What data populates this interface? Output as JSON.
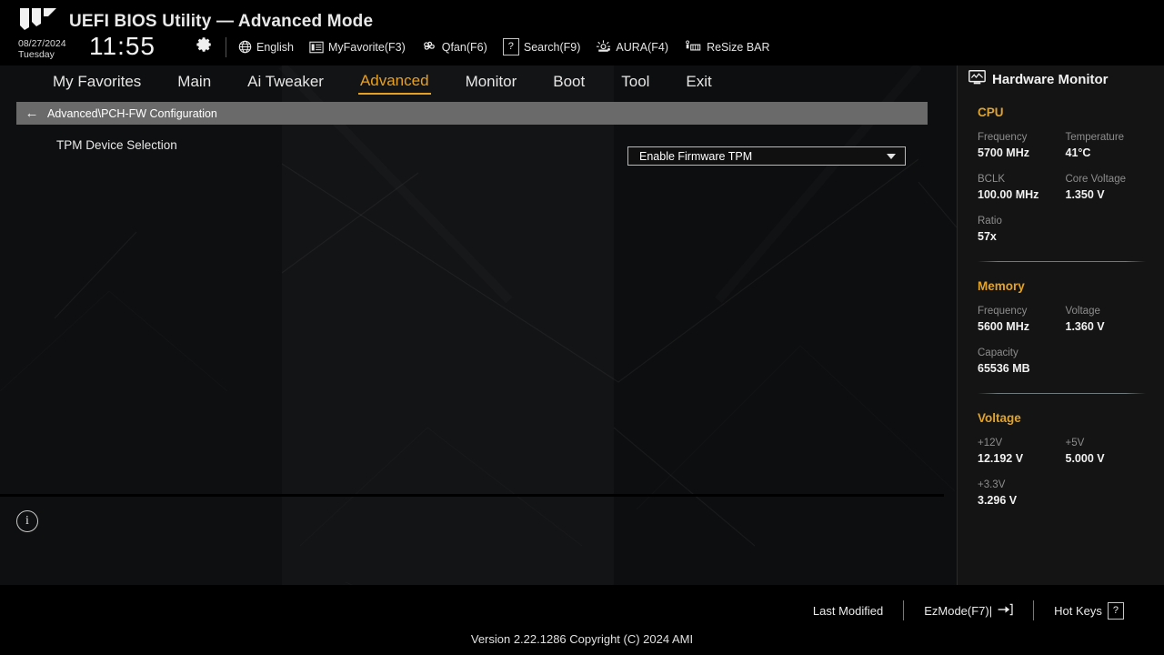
{
  "header": {
    "logo_icon": "tuf-logo-icon",
    "title": "UEFI BIOS Utility — Advanced Mode",
    "date": "08/27/2024",
    "weekday": "Tuesday",
    "time": "11:55",
    "gear_icon": "gear-icon",
    "items": [
      {
        "icon": "globe-icon",
        "label": "English"
      },
      {
        "icon": "list-icon",
        "label": "MyFavorite(F3)"
      },
      {
        "icon": "fan-icon",
        "label": "Qfan(F6)"
      },
      {
        "icon": "question-box-icon",
        "label": "Search(F9)"
      },
      {
        "icon": "aura-light-icon",
        "label": "AURA(F4)"
      },
      {
        "icon": "resize-bar-icon",
        "label": "ReSize BAR"
      }
    ]
  },
  "tabs": [
    {
      "label": "My Favorites",
      "active": false
    },
    {
      "label": "Main",
      "active": false
    },
    {
      "label": "Ai Tweaker",
      "active": false
    },
    {
      "label": "Advanced",
      "active": true
    },
    {
      "label": "Monitor",
      "active": false
    },
    {
      "label": "Boot",
      "active": false
    },
    {
      "label": "Tool",
      "active": false
    },
    {
      "label": "Exit",
      "active": false
    }
  ],
  "breadcrumb": {
    "back_icon": "arrow-left-icon",
    "path": "Advanced\\PCH-FW Configuration"
  },
  "main": {
    "options": [
      {
        "label": "TPM Device Selection",
        "value": "Enable Firmware TPM",
        "caret_icon": "chevron-down-icon"
      }
    ],
    "info_icon": "info-icon",
    "help_text": ""
  },
  "hardware_monitor": {
    "icon": "monitor-waveform-icon",
    "title": "Hardware Monitor",
    "groups": [
      {
        "name": "CPU",
        "rows": [
          [
            {
              "key": "Frequency",
              "value": "5700 MHz"
            },
            {
              "key": "Temperature",
              "value": "41°C"
            }
          ],
          [
            {
              "key": "BCLK",
              "value": "100.00 MHz"
            },
            {
              "key": "Core Voltage",
              "value": "1.350 V"
            }
          ],
          [
            {
              "key": "Ratio",
              "value": "57x"
            }
          ]
        ]
      },
      {
        "name": "Memory",
        "rows": [
          [
            {
              "key": "Frequency",
              "value": "5600 MHz"
            },
            {
              "key": "Voltage",
              "value": "1.360 V"
            }
          ],
          [
            {
              "key": "Capacity",
              "value": "65536 MB"
            }
          ]
        ]
      },
      {
        "name": "Voltage",
        "rows": [
          [
            {
              "key": "+12V",
              "value": "12.192 V"
            },
            {
              "key": "+5V",
              "value": "5.000 V"
            }
          ],
          [
            {
              "key": "+3.3V",
              "value": "3.296 V"
            }
          ]
        ]
      }
    ]
  },
  "footer": {
    "last_modified": "Last Modified",
    "ezmode": "EzMode(F7)|",
    "ezmode_icon": "arrow-into-bracket-icon",
    "hotkeys": "Hot Keys",
    "hotkeys_key": "?",
    "version": "Version 2.22.1286 Copyright (C) 2024 AMI"
  },
  "colors": {
    "accent": "#e8a020",
    "group_heading": "#e0a32e",
    "breadcrumb_bg": "#6a6a6a",
    "panel_bg": "#141414",
    "page_bg": "#050505",
    "text": "#e9e9e9",
    "muted": "#8d8d8d"
  }
}
